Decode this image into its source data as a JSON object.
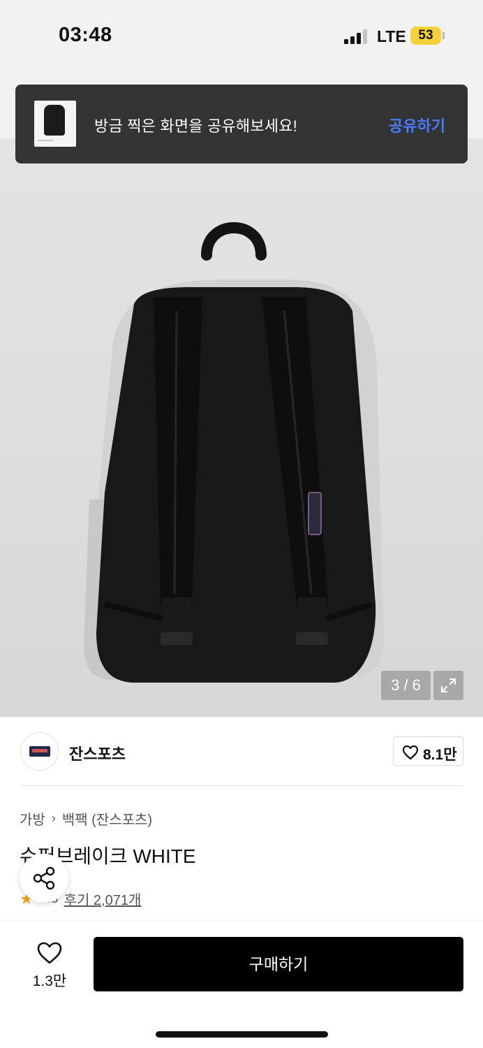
{
  "status_bar": {
    "time": "03:48",
    "network": "LTE",
    "battery": "53",
    "battery_color": "#f5d23a"
  },
  "toast": {
    "message": "방금 찍은 화면을 공유해보세요!",
    "action": "공유하기",
    "action_color": "#4b7bff"
  },
  "gallery": {
    "counter": "3 / 6",
    "expand_icon": "expand-icon",
    "thumbnail_chevron": "›"
  },
  "brand": {
    "name": "잔스포츠",
    "like_count": "8.1만"
  },
  "product": {
    "breadcrumb": [
      "가방",
      "백팩 (잔스포츠)"
    ],
    "breadcrumb_separator": "›",
    "title": "슈퍼브레이크 WHITE",
    "rating": "4.8",
    "reviews": "후기 2,071개"
  },
  "bottom": {
    "wish_count": "1.3만",
    "buy_label": "구매하기"
  }
}
